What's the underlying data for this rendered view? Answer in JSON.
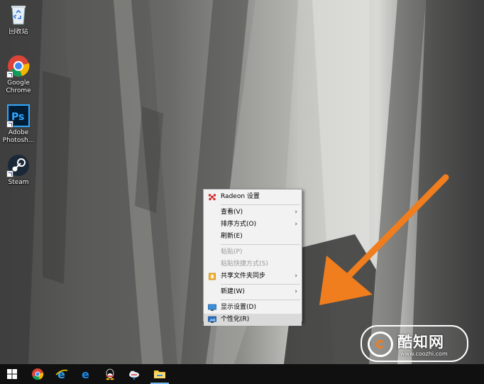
{
  "desktop": {
    "icons": [
      {
        "label": "回收站",
        "icon": "recycle-bin-icon"
      },
      {
        "label": "Google Chrome",
        "icon": "chrome-icon"
      },
      {
        "label": "Adobe Photosh...",
        "icon": "photoshop-icon"
      },
      {
        "label": "Steam",
        "icon": "steam-icon"
      }
    ]
  },
  "context_menu": {
    "items": [
      {
        "label": "Radeon 设置",
        "icon": "radeon-icon",
        "enabled": true
      },
      {
        "label": "查看(V)",
        "submenu": true,
        "enabled": true
      },
      {
        "label": "排序方式(O)",
        "submenu": true,
        "enabled": true
      },
      {
        "label": "刷新(E)",
        "enabled": true
      },
      {
        "label": "粘贴(P)",
        "enabled": false
      },
      {
        "label": "粘贴快捷方式(S)",
        "enabled": false
      },
      {
        "label": "共享文件夹同步",
        "icon": "sync-folder-icon",
        "submenu": true,
        "enabled": true
      },
      {
        "label": "新建(W)",
        "submenu": true,
        "enabled": true
      },
      {
        "label": "显示设置(D)",
        "icon": "display-settings-icon",
        "enabled": true
      },
      {
        "label": "个性化(R)",
        "icon": "personalize-icon",
        "enabled": true,
        "highlighted": true
      }
    ],
    "submenu_glyph": "›"
  },
  "watermark": {
    "title": "酷知网",
    "url": "www.coozhi.com"
  },
  "taskbar": {
    "items": [
      {
        "name": "start-button",
        "icon": "windows-icon"
      },
      {
        "name": "chrome",
        "icon": "chrome-icon"
      },
      {
        "name": "internet-explorer",
        "icon": "ie-icon"
      },
      {
        "name": "edge",
        "icon": "edge-icon"
      },
      {
        "name": "qq",
        "icon": "qq-icon"
      },
      {
        "name": "cloud-app",
        "icon": "cloud-icon"
      },
      {
        "name": "file-explorer",
        "icon": "folder-icon",
        "active": true
      }
    ]
  },
  "colors": {
    "accent_arrow": "#f07d1e",
    "menu_bg": "#f2f2f2",
    "menu_hover": "#dadada",
    "taskbar_bg": "#101010"
  }
}
